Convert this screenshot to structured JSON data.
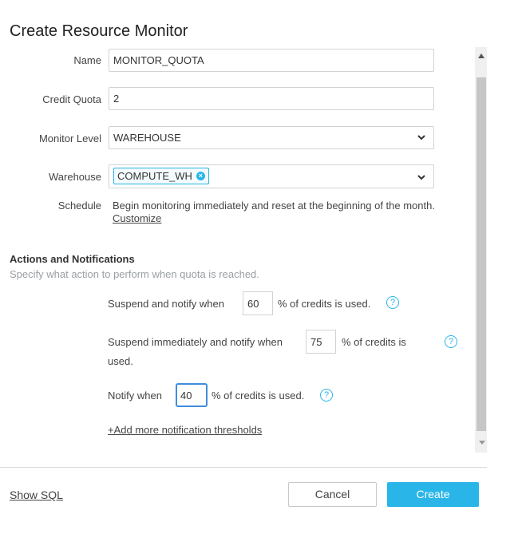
{
  "dialog": {
    "title": "Create Resource Monitor"
  },
  "form": {
    "name": {
      "label": "Name",
      "value": "MONITOR_QUOTA"
    },
    "credit_quota": {
      "label": "Credit Quota",
      "value": "2"
    },
    "monitor_level": {
      "label": "Monitor Level",
      "value": "WAREHOUSE"
    },
    "warehouse": {
      "label": "Warehouse",
      "chip": "COMPUTE_WH"
    },
    "schedule": {
      "label": "Schedule",
      "text": "Begin monitoring immediately and reset at the beginning of the month.",
      "customize_link": "Customize"
    }
  },
  "actions": {
    "title": "Actions and Notifications",
    "subtitle": "Specify what action to perform when quota is reached.",
    "suspend_notify": {
      "prefix": "Suspend and notify when",
      "value": "60",
      "suffix": "% of credits is used."
    },
    "suspend_immediately": {
      "prefix": "Suspend immediately and notify when",
      "value": "75",
      "suffix": "% of credits is",
      "suffix2": "used."
    },
    "notify": {
      "prefix": "Notify when",
      "value": "40",
      "suffix": "% of credits is used."
    },
    "help_glyph": "?",
    "add_more_link": "+Add more notification thresholds"
  },
  "footer": {
    "show_sql": "Show SQL",
    "cancel": "Cancel",
    "create": "Create"
  },
  "colors": {
    "accent": "#29b5e8",
    "focus": "#3e8edc"
  }
}
